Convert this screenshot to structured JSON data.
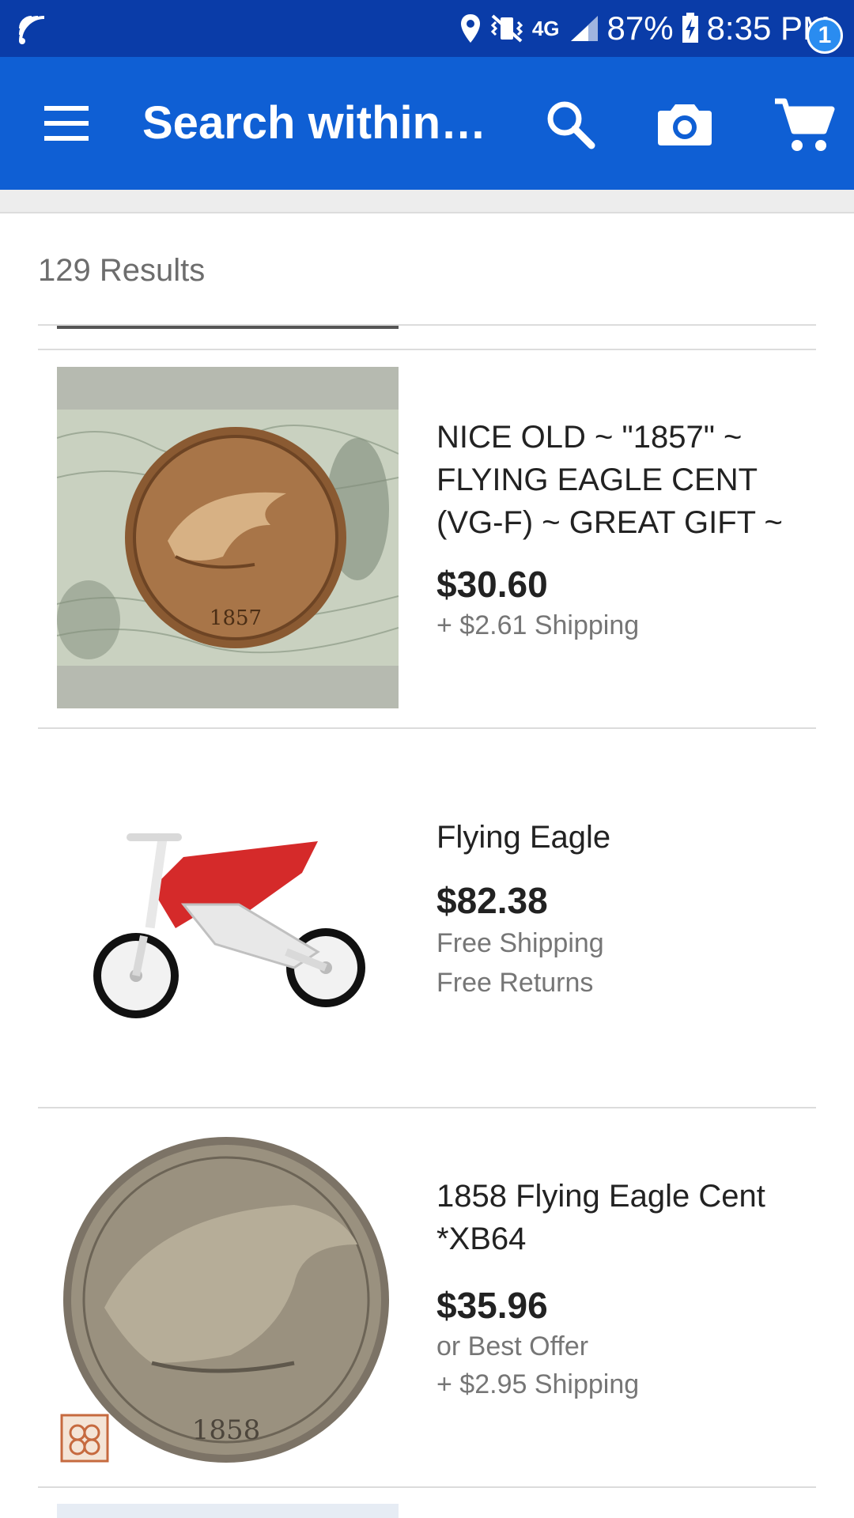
{
  "status_bar": {
    "network": "4G",
    "battery": "87%",
    "time": "8:35 PM"
  },
  "app_bar": {
    "search_title": "Search within…",
    "cart_count": "1",
    "icons": [
      "menu-icon",
      "search-icon",
      "camera-icon",
      "cart-icon"
    ],
    "colors": {
      "status_bar": "#0a3ca8",
      "app_bar": "#0f5fd4",
      "badge": "#2a8cf0"
    }
  },
  "results": {
    "count_label": "129 Results",
    "items": [
      {
        "title": "NICE OLD ~ \"1857\" ~ FLYING EAGLE CENT (VG-F) ~ GREAT GIFT ~ …",
        "price": "$30.60",
        "shipping": "+ $2.61 Shipping",
        "image_year": "1857"
      },
      {
        "title": "Flying Eagle",
        "price": "$82.38",
        "shipping": "Free Shipping",
        "returns": "Free Returns"
      },
      {
        "title": "1858 Flying Eagle Cent *XB64",
        "price": "$35.96",
        "offer": "or Best Offer",
        "shipping": "+ $2.95 Shipping",
        "image_year": "1858"
      }
    ]
  }
}
